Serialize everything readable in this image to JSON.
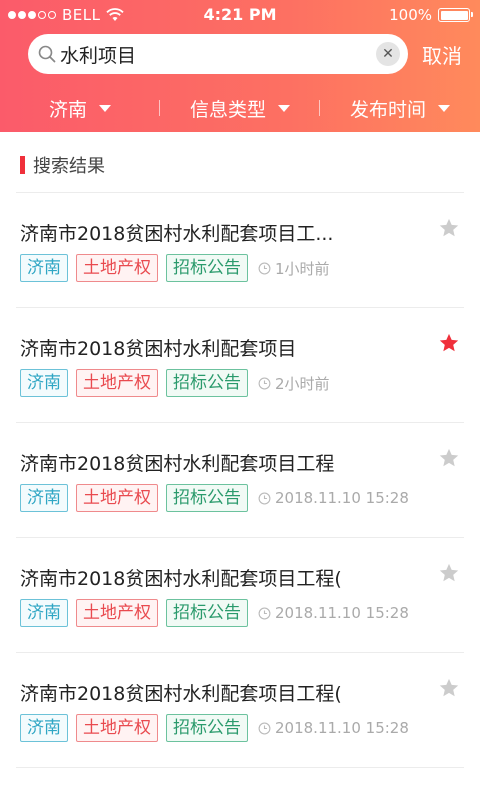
{
  "status_bar": {
    "carrier": "BELL",
    "time": "4:21 PM",
    "battery": "100%"
  },
  "search": {
    "value": "水利项目",
    "cancel_label": "取消"
  },
  "filters": [
    {
      "label": "济南"
    },
    {
      "label": "信息类型"
    },
    {
      "label": "发布时间"
    }
  ],
  "section": {
    "title": "搜索结果"
  },
  "results": [
    {
      "title": "济南市2018贫困村水利配套项目工...",
      "tags": [
        "济南",
        "土地产权",
        "招标公告"
      ],
      "time": "1小时前",
      "starred": false
    },
    {
      "title": "济南市2018贫困村水利配套项目",
      "tags": [
        "济南",
        "土地产权",
        "招标公告"
      ],
      "time": "2小时前",
      "starred": true
    },
    {
      "title": "济南市2018贫困村水利配套项目工程",
      "tags": [
        "济南",
        "土地产权",
        "招标公告"
      ],
      "time": "2018.11.10 15:28",
      "starred": false
    },
    {
      "title": "济南市2018贫困村水利配套项目工程(",
      "tags": [
        "济南",
        "土地产权",
        "招标公告"
      ],
      "time": "2018.11.10 15:28",
      "starred": false
    },
    {
      "title": "济南市2018贫困村水利配套项目工程(",
      "tags": [
        "济南",
        "土地产权",
        "招标公告"
      ],
      "time": "2018.11.10 15:28",
      "starred": false
    }
  ],
  "colors": {
    "star_active": "#f0303b",
    "star_inactive": "#cccccc"
  }
}
